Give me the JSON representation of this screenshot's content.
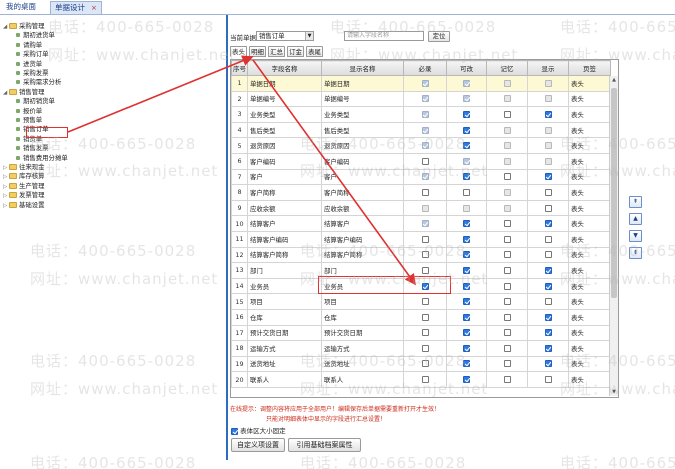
{
  "tabs": {
    "home": "我的桌面",
    "active": "单据设计",
    "close": "×"
  },
  "tree": [
    {
      "label": "采购管理",
      "level": 0,
      "type": "folder"
    },
    {
      "label": "期初进货单",
      "level": 2,
      "type": "leaf"
    },
    {
      "label": "请购单",
      "level": 2,
      "type": "leaf"
    },
    {
      "label": "采购订单",
      "level": 2,
      "type": "leaf"
    },
    {
      "label": "进货单",
      "level": 2,
      "type": "leaf"
    },
    {
      "label": "采购发票",
      "level": 2,
      "type": "leaf"
    },
    {
      "label": "采购需求分析",
      "level": 2,
      "type": "leaf"
    },
    {
      "label": "销售管理",
      "level": 0,
      "type": "folder"
    },
    {
      "label": "期初销货单",
      "level": 2,
      "type": "leaf"
    },
    {
      "label": "报价单",
      "level": 2,
      "type": "leaf"
    },
    {
      "label": "预售单",
      "level": 2,
      "type": "leaf"
    },
    {
      "label": "销售订单",
      "level": 2,
      "type": "leaf"
    },
    {
      "label": "销货单",
      "level": 2,
      "type": "leaf"
    },
    {
      "label": "销售发票",
      "level": 2,
      "type": "leaf"
    },
    {
      "label": "销售费用分摊单",
      "level": 2,
      "type": "leaf"
    },
    {
      "label": "往来现金",
      "level": 0,
      "type": "folder"
    },
    {
      "label": "库存核算",
      "level": 0,
      "type": "folder"
    },
    {
      "label": "生产管理",
      "level": 0,
      "type": "folder"
    },
    {
      "label": "发票管理",
      "level": 0,
      "type": "folder"
    },
    {
      "label": "基础设置",
      "level": 0,
      "type": "folder"
    }
  ],
  "toolbar": {
    "bill_label": "当前单据",
    "bill_value": "销售订单",
    "search_placeholder": "请输入字段名称",
    "locate_button": "定位"
  },
  "subtabs": [
    "表头",
    "明细",
    "汇总",
    "订金",
    "表尾"
  ],
  "columns": [
    "序号",
    "字段名称",
    "显示名称",
    "必录",
    "可改",
    "记忆",
    "显示",
    "页签"
  ],
  "rows": [
    {
      "no": "1",
      "field": "单据日期",
      "display": "单据日期",
      "req": [
        1,
        1
      ],
      "edit": [
        1,
        1
      ],
      "mem": [
        0,
        1
      ],
      "show": [
        0,
        1
      ],
      "tab": "表头"
    },
    {
      "no": "2",
      "field": "单据编号",
      "display": "单据编号",
      "req": [
        1,
        1
      ],
      "edit": [
        1,
        1
      ],
      "mem": [
        0,
        1
      ],
      "show": [
        0,
        1
      ],
      "tab": "表头"
    },
    {
      "no": "3",
      "field": "业务类型",
      "display": "业务类型",
      "req": [
        1,
        1
      ],
      "edit": [
        1,
        0
      ],
      "mem": [
        0,
        0
      ],
      "show": [
        1,
        0
      ],
      "tab": "表头"
    },
    {
      "no": "4",
      "field": "售后类型",
      "display": "售后类型",
      "req": [
        1,
        1
      ],
      "edit": [
        1,
        0
      ],
      "mem": [
        0,
        1
      ],
      "show": [
        0,
        1
      ],
      "tab": "表头"
    },
    {
      "no": "5",
      "field": "退货原因",
      "display": "退货原因",
      "req": [
        1,
        1
      ],
      "edit": [
        1,
        0
      ],
      "mem": [
        0,
        1
      ],
      "show": [
        0,
        1
      ],
      "tab": "表头"
    },
    {
      "no": "6",
      "field": "客户编码",
      "display": "客户编码",
      "req": [
        0,
        0
      ],
      "edit": [
        1,
        1
      ],
      "mem": [
        0,
        1
      ],
      "show": [
        0,
        1
      ],
      "tab": "表头"
    },
    {
      "no": "7",
      "field": "客户",
      "display": "客户",
      "req": [
        1,
        1
      ],
      "edit": [
        1,
        0
      ],
      "mem": [
        0,
        0
      ],
      "show": [
        1,
        0
      ],
      "tab": "表头"
    },
    {
      "no": "8",
      "field": "客户简称",
      "display": "客户简称",
      "req": [
        0,
        0
      ],
      "edit": [
        0,
        0
      ],
      "mem": [
        0,
        1
      ],
      "show": [
        0,
        0
      ],
      "tab": "表头"
    },
    {
      "no": "9",
      "field": "应收余额",
      "display": "应收余额",
      "req": [
        0,
        1
      ],
      "edit": [
        0,
        1
      ],
      "mem": [
        0,
        1
      ],
      "show": [
        0,
        0
      ],
      "tab": "表头"
    },
    {
      "no": "10",
      "field": "结算客户",
      "display": "结算客户",
      "req": [
        1,
        1
      ],
      "edit": [
        1,
        0
      ],
      "mem": [
        0,
        0
      ],
      "show": [
        1,
        0
      ],
      "tab": "表头"
    },
    {
      "no": "11",
      "field": "结算客户编码",
      "display": "结算客户编码",
      "req": [
        0,
        0
      ],
      "edit": [
        1,
        0
      ],
      "mem": [
        0,
        0
      ],
      "show": [
        0,
        0
      ],
      "tab": "表头"
    },
    {
      "no": "12",
      "field": "结算客户简称",
      "display": "结算客户简称",
      "req": [
        0,
        0
      ],
      "edit": [
        1,
        0
      ],
      "mem": [
        0,
        0
      ],
      "show": [
        0,
        0
      ],
      "tab": "表头"
    },
    {
      "no": "13",
      "field": "部门",
      "display": "部门",
      "req": [
        0,
        0
      ],
      "edit": [
        1,
        0
      ],
      "mem": [
        0,
        0
      ],
      "show": [
        1,
        0
      ],
      "tab": "表头"
    },
    {
      "no": "14",
      "field": "业务员",
      "display": "业务员",
      "req": [
        1,
        0
      ],
      "edit": [
        1,
        0
      ],
      "mem": [
        0,
        0
      ],
      "show": [
        1,
        0
      ],
      "tab": "表头"
    },
    {
      "no": "15",
      "field": "项目",
      "display": "项目",
      "req": [
        0,
        0
      ],
      "edit": [
        1,
        0
      ],
      "mem": [
        0,
        0
      ],
      "show": [
        0,
        0
      ],
      "tab": "表头"
    },
    {
      "no": "16",
      "field": "仓库",
      "display": "仓库",
      "req": [
        0,
        0
      ],
      "edit": [
        1,
        0
      ],
      "mem": [
        0,
        0
      ],
      "show": [
        1,
        0
      ],
      "tab": "表头"
    },
    {
      "no": "17",
      "field": "预计交货日期",
      "display": "预计交货日期",
      "req": [
        0,
        0
      ],
      "edit": [
        1,
        0
      ],
      "mem": [
        0,
        0
      ],
      "show": [
        1,
        0
      ],
      "tab": "表头"
    },
    {
      "no": "18",
      "field": "运输方式",
      "display": "运输方式",
      "req": [
        0,
        0
      ],
      "edit": [
        1,
        0
      ],
      "mem": [
        0,
        0
      ],
      "show": [
        1,
        0
      ],
      "tab": "表头"
    },
    {
      "no": "19",
      "field": "送货地址",
      "display": "送货地址",
      "req": [
        0,
        0
      ],
      "edit": [
        1,
        0
      ],
      "mem": [
        0,
        0
      ],
      "show": [
        1,
        0
      ],
      "tab": "表头"
    },
    {
      "no": "20",
      "field": "联系人",
      "display": "联系人",
      "req": [
        0,
        0
      ],
      "edit": [
        1,
        0
      ],
      "mem": [
        0,
        0
      ],
      "show": [
        0,
        0
      ],
      "tab": "表头"
    }
  ],
  "hint_line1": "在线提示：调整内容将应用于全部用户！编辑保存后单据需要重新打开才生效！",
  "hint_line2": "只能对明细表体中显示的字段进行汇总设置！",
  "checkbox_label": "表体区大小固定",
  "buttons": {
    "custom": "自定义项设置",
    "ref": "引用基础档案属性"
  },
  "move_buttons": [
    "top",
    "up",
    "down",
    "bottom"
  ],
  "watermark": {
    "phone": "电话：400-665-0028",
    "site": "网址：www.chanjet.net"
  },
  "colors": {
    "accent": "#2d6cc0",
    "annotation": "#e03030",
    "hint": "#cc2a1a",
    "highlight_row": "#fdf9d4"
  }
}
